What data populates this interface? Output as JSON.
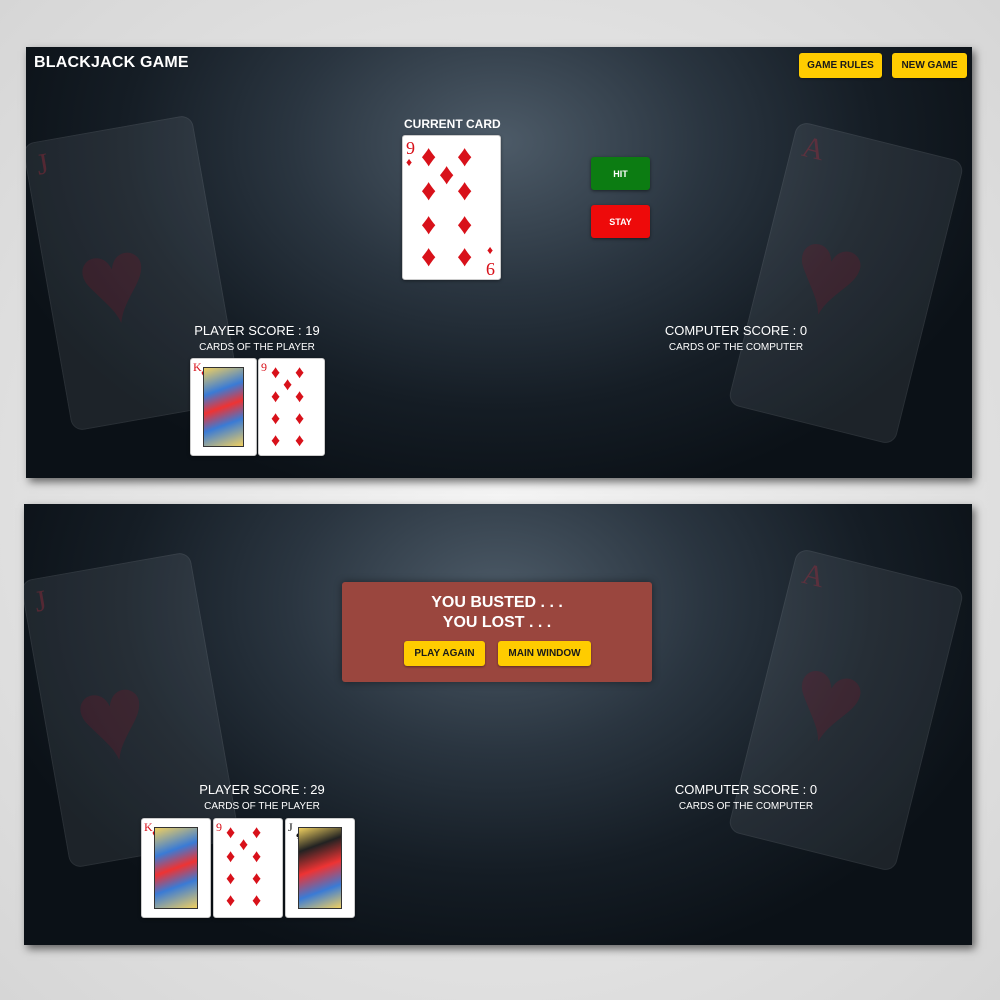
{
  "top": {
    "title": "BLACKJACK GAME",
    "buttons": {
      "rules": "GAME RULES",
      "new_game": "NEW GAME",
      "hit": "HIT",
      "stay": "STAY"
    },
    "current_label": "CURRENT CARD",
    "current_card": {
      "rank": "9",
      "suit": "♦"
    },
    "player_score": "PLAYER SCORE : 19",
    "player_sub": "CARDS OF THE PLAYER",
    "computer_score": "COMPUTER SCORE : 0",
    "computer_sub": "CARDS OF THE COMPUTER",
    "player_cards": [
      {
        "rank": "K",
        "suit": "♥"
      },
      {
        "rank": "9",
        "suit": "♦"
      }
    ]
  },
  "bottom": {
    "modal_line1": "YOU BUSTED . . .",
    "modal_line2": "YOU LOST . . .",
    "buttons": {
      "play_again": "PLAY AGAIN",
      "main_window": "MAIN WINDOW"
    },
    "player_score": "PLAYER SCORE : 29",
    "player_sub": "CARDS OF THE PLAYER",
    "computer_score": "COMPUTER SCORE : 0",
    "computer_sub": "CARDS OF THE COMPUTER",
    "player_cards": [
      {
        "rank": "K",
        "suit": "♥"
      },
      {
        "rank": "9",
        "suit": "♦"
      },
      {
        "rank": "J",
        "suit": "♠"
      }
    ]
  },
  "background_cards": [
    {
      "rank": "J",
      "suit": "♥"
    },
    {
      "rank": "A",
      "suit": "♥"
    }
  ],
  "colors": {
    "accent_button": "#ffcc00",
    "hit": "#0c7c12",
    "stay": "#ee0a0a",
    "modal": "#9a463e"
  }
}
